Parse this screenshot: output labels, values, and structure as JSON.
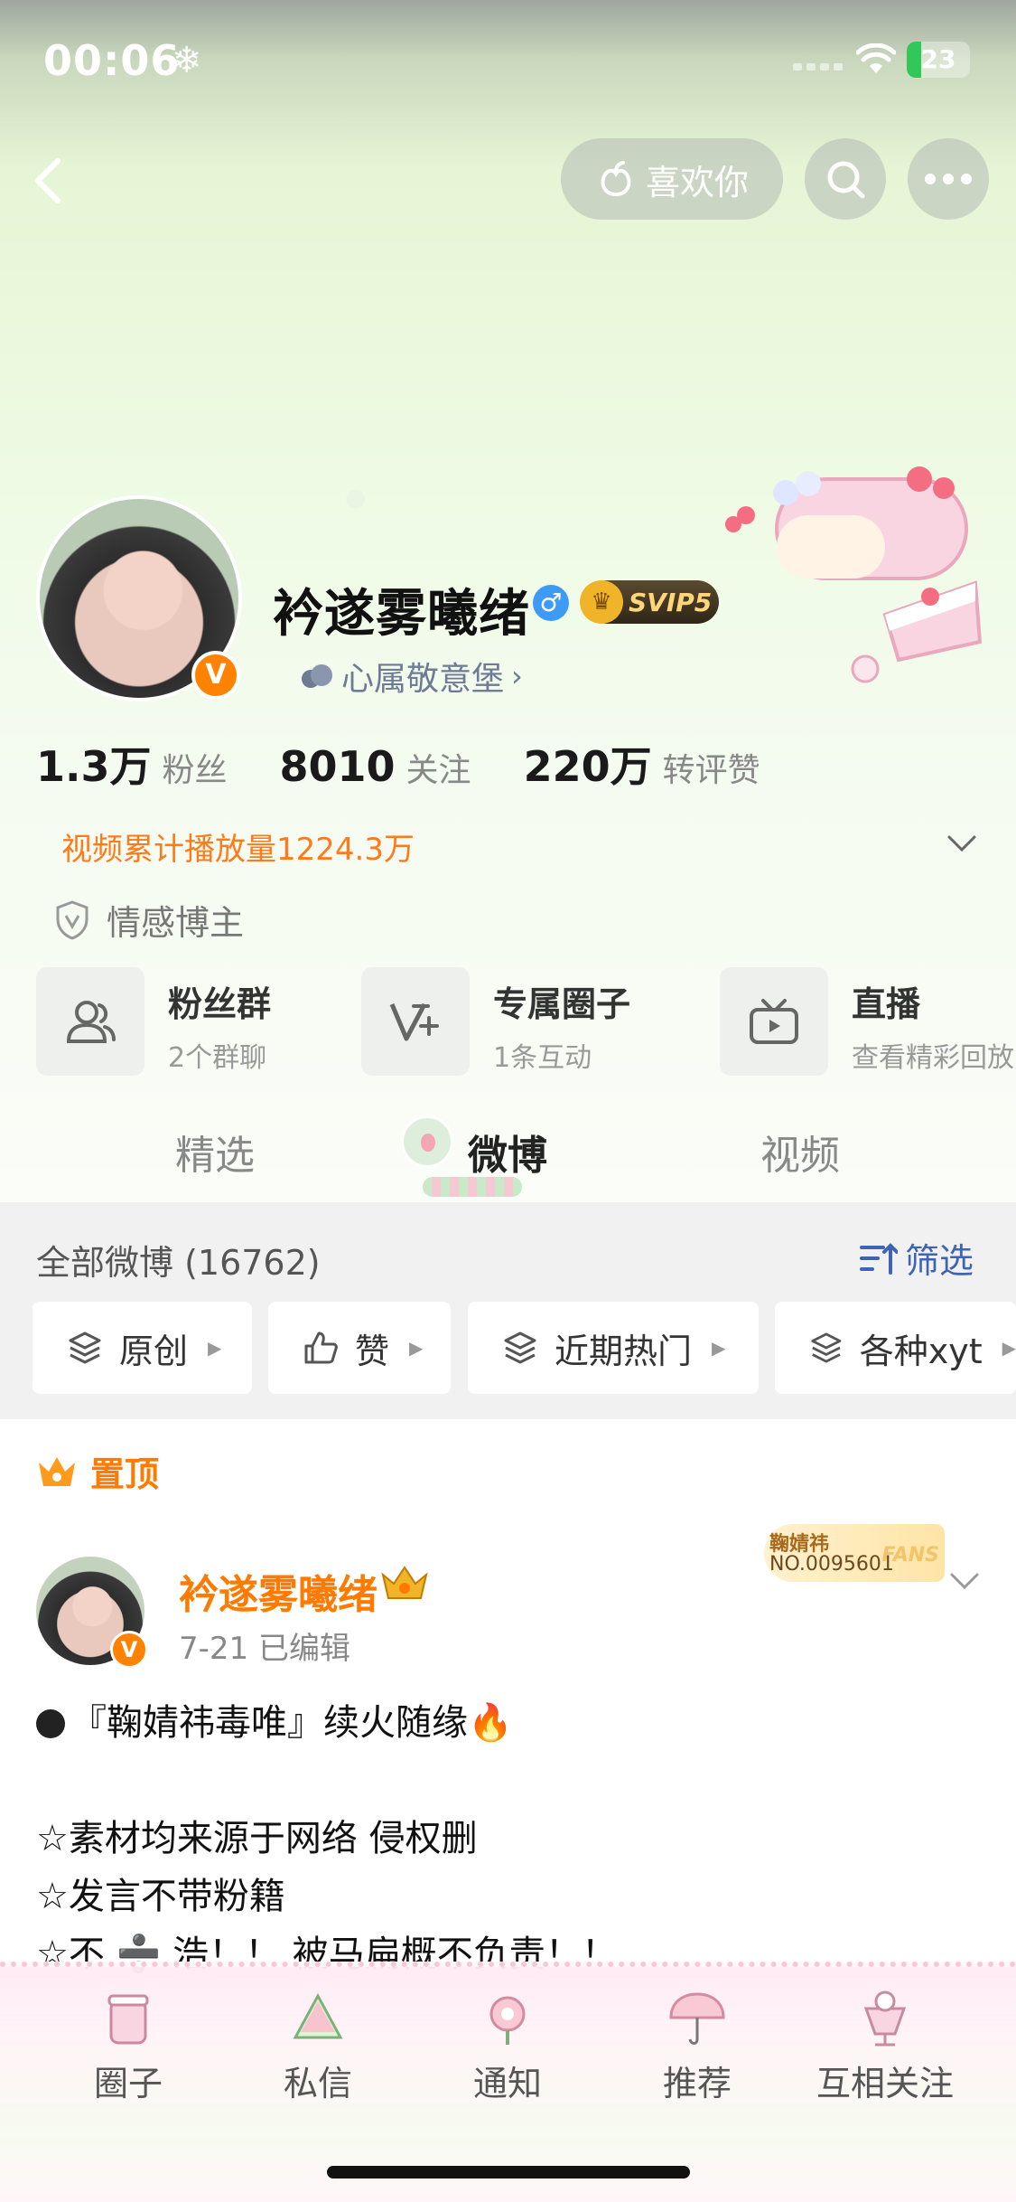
{
  "status_bar": {
    "time": "00:06",
    "battery": "23",
    "battery_fill": 0.23
  },
  "navbar": {
    "like_label": "喜欢你"
  },
  "profile": {
    "name": "衿遂雾曦绪",
    "vip_label": "SVIP5",
    "verified_mark": "V",
    "gender_symbol": "♂",
    "group_link": "心属敬意堡",
    "stats": [
      {
        "value": "1.3万",
        "label": "粉丝"
      },
      {
        "value": "8010",
        "label": "关注"
      },
      {
        "value": "220万",
        "label": "转评赞"
      }
    ],
    "video_plays": "视频累计播放量1224.3万",
    "tag": "情感博主"
  },
  "entries": [
    {
      "title": "粉丝群",
      "subtitle": "2个群聊"
    },
    {
      "title": "专属圈子",
      "subtitle": "1条互动"
    },
    {
      "title": "直播",
      "subtitle": "查看精彩回放"
    }
  ],
  "tabs": {
    "featured": "精选",
    "weibo": "微博",
    "video": "视频"
  },
  "filter": {
    "all_label": "全部微博 (16762)",
    "filter_label": "筛选",
    "chips": [
      "原创",
      "赞",
      "近期热门",
      "各种xyt"
    ]
  },
  "pinned_label": "置顶",
  "post": {
    "author": "衿遂雾曦绪",
    "meta": "7-21  已编辑",
    "badge_name": "鞠婧祎",
    "badge_no": "NO.0095601",
    "badge_fans": "FANS",
    "lines": [
      "『鞠婧祎毒唯』续火随缘🔥",
      "",
      "☆素材均来源于网络 侵权删",
      "☆发言不带粉籍",
      "☆不 ➗ 浩！！ 被马扁概不负责！！"
    ]
  },
  "bottom_nav": [
    "圈子",
    "私信",
    "通知",
    "推荐",
    "互相关注"
  ],
  "colors": {
    "accent_orange": "#ff7a00",
    "link_blue": "#3f64b4",
    "vip_gold": "#ffd77a"
  }
}
